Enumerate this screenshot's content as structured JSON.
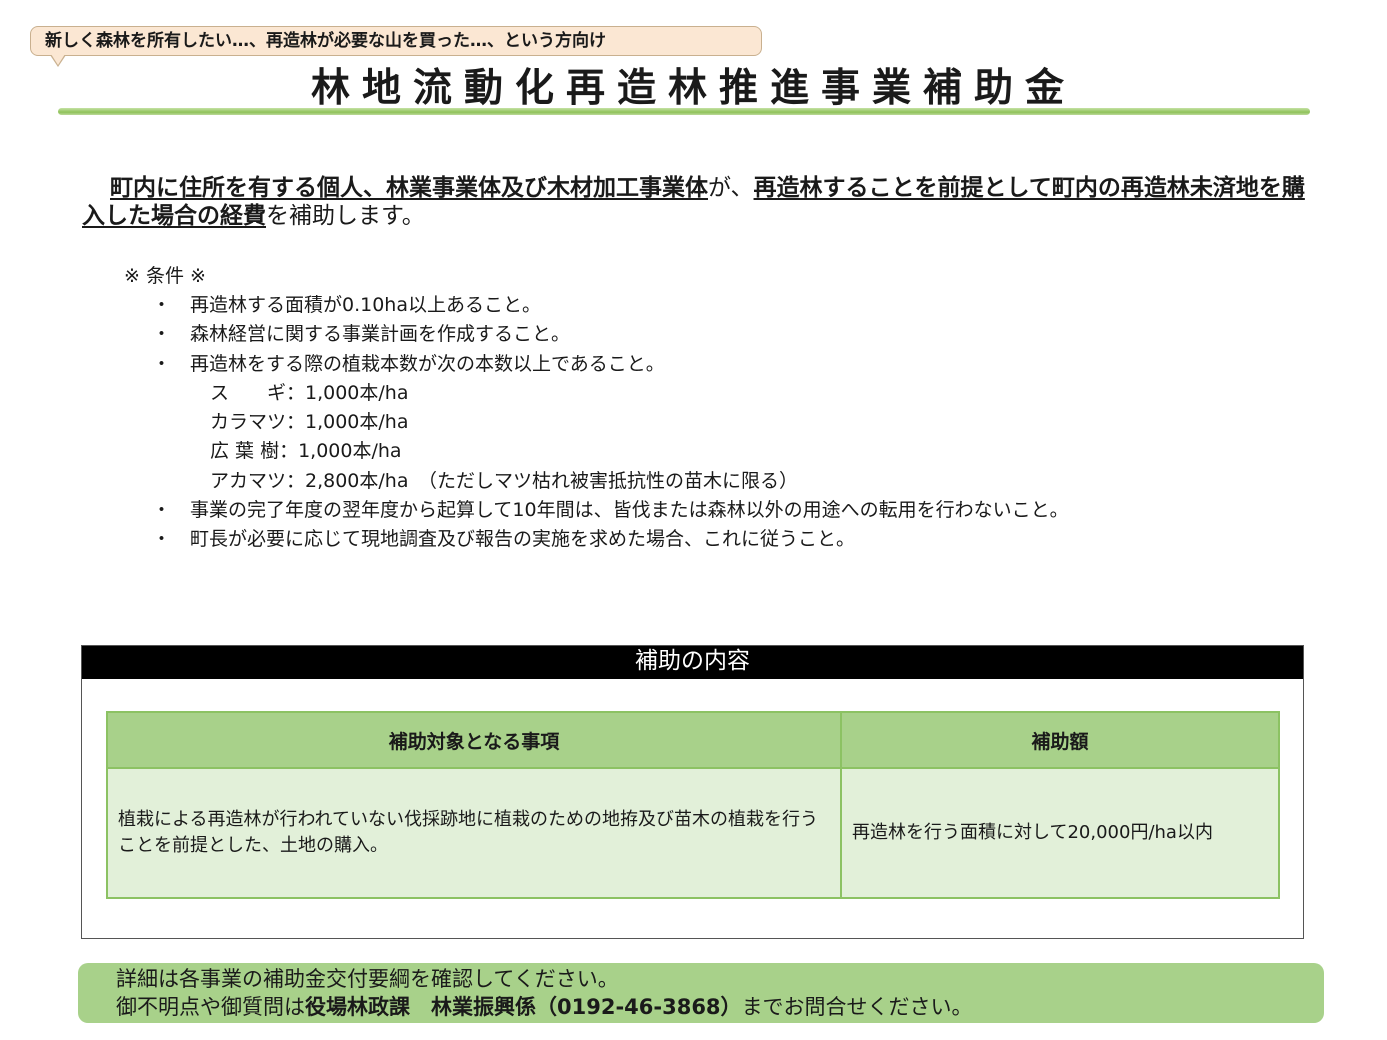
{
  "bubble": {
    "text": "新しく森林を所有したい…、再造林が必要な山を買った…、という方向け"
  },
  "title": "林地流動化再造林推進事業補助金",
  "intro": {
    "part1": "町内に住所を有する個人、林業事業体及び木材加工事業体",
    "part2": "が、",
    "part3": "再造林することを前提として町内の再造林未済地を購入した場合の経費",
    "part4": "を補助します。"
  },
  "conditions": {
    "header": "※ 条件 ※",
    "bullet": "・",
    "items": [
      "再造林する面積が0.10ha以上あること。",
      "森林経営に関する事業計画を作成すること。",
      "再造林をする際の植栽本数が次の本数以上であること。"
    ],
    "species": [
      "ス　　ギ：1,000本/ha",
      "カラマツ：1,000本/ha",
      "広 葉 樹：1,000本/ha",
      "アカマツ：2,800本/ha　（ただしマツ枯れ被害抵抗性の苗木に限る）"
    ],
    "items_after": [
      "事業の完了年度の翌年度から起算して10年間は、皆伐または森林以外の用途への転用を行わないこと。",
      "町長が必要に応じて現地調査及び報告の実施を求めた場合、これに従うこと。"
    ]
  },
  "panel": {
    "header": "補助の内容",
    "table": {
      "headers": [
        "補助対象となる事項",
        "補助額"
      ],
      "rows": [
        [
          "植栽による再造林が行われていない伐採跡地に植栽のための地拵及び苗木の植栽を行うことを前提とした、土地の購入。",
          "再造林を行う面積に対して20,000円/ha以内"
        ]
      ]
    }
  },
  "footer": {
    "line1": "詳細は各事業の補助金交付要綱を確認してください。",
    "line2_pre": "御不明点や御質問は",
    "line2_bold": "役場林政課　林業振興係（0192-46-3868）",
    "line2_post": "までお問合せください。"
  },
  "colors": {
    "bubble_bg": "#fbe7d3",
    "title_rule": "#8fc25a",
    "table_header": "#a8d18a",
    "table_cell": "#e2f0d9",
    "panel_header": "#000000",
    "footer_bg": "#a8d18a"
  }
}
